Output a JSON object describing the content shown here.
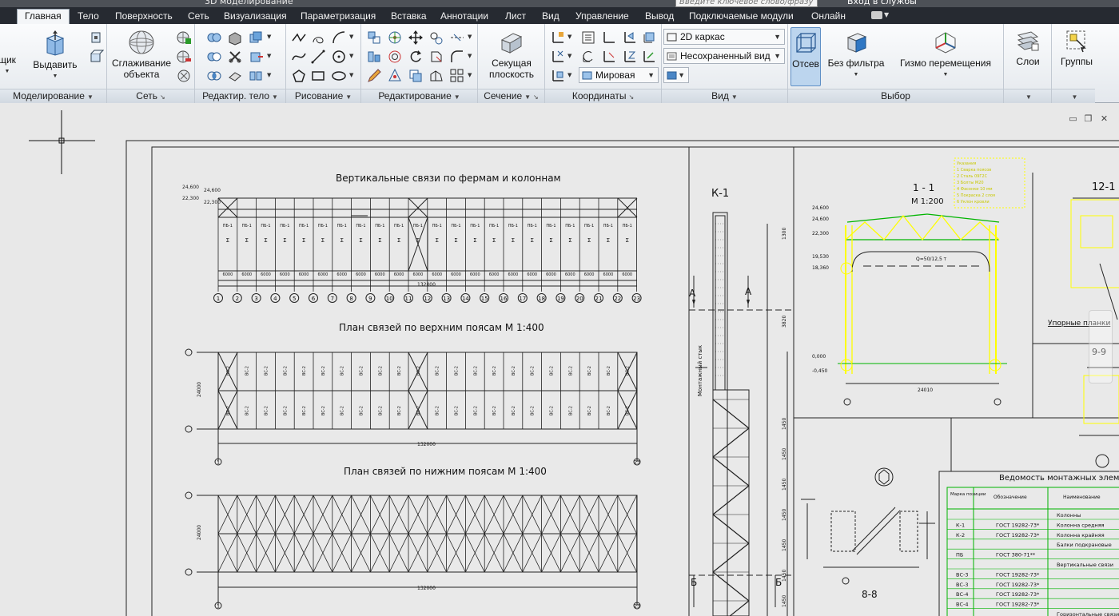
{
  "titlebar": {
    "document": "3D моделирование",
    "search_placeholder": "Введите ключевое слово/фразу",
    "login": "Вход в службы"
  },
  "tabs": [
    {
      "label": "Главная"
    },
    {
      "label": "Тело"
    },
    {
      "label": "Поверхность"
    },
    {
      "label": "Сеть"
    },
    {
      "label": "Визуализация"
    },
    {
      "label": "Параметризация"
    },
    {
      "label": "Вставка"
    },
    {
      "label": "Аннотации"
    },
    {
      "label": "Лист"
    },
    {
      "label": "Вид"
    },
    {
      "label": "Управление"
    },
    {
      "label": "Вывод"
    },
    {
      "label": "Подключаемые модули"
    },
    {
      "label": "Онлайн"
    }
  ],
  "ribbon": {
    "box_label": "щик",
    "extrude_label": "Выдавить",
    "smooth_label_1": "Сглаживание",
    "smooth_label_2": "объекта",
    "section_label_1": "Секущая",
    "section_label_2": "плоскость",
    "visual_style": "2D каркас",
    "saved_view": "Несохраненный вид",
    "ucs": "Мировая",
    "culling_label": "Отсев",
    "filter_label": "Без фильтра",
    "gizmo_label": "Гизмо перемещения",
    "layers_label": "Слои",
    "groups_label": "Группы",
    "panels": {
      "modeling": "Моделирование",
      "mesh": "Сеть",
      "solid_edit": "Редактир. тело",
      "draw": "Рисование",
      "modify": "Редактирование",
      "section": "Сечение",
      "coordinates": "Координаты",
      "view": "Вид",
      "selection": "Выбор"
    }
  },
  "drawing": {
    "title_vertical": "Вертикальные связи по фермам и колоннам",
    "title_top": "План связей по верхним поясам М 1:400",
    "title_bottom": "План связей по нижним поясам М 1:400",
    "column_mark": "К-1",
    "section_mark_1": "1 - 1",
    "section_scale": "М 1:200",
    "section_mark_12": "12-1",
    "section_99": "9-9",
    "section_88": "8-8",
    "dim_total": "132000",
    "dim_span": "24000",
    "dim_section": "24010",
    "stop_plates": "Упорные планки",
    "mounting_stage": "Монтажный стык",
    "crane": "Q=50/12,5 т",
    "marks": {
      "section_a": "А",
      "section_b": "Б"
    },
    "axis_numbers": [
      "1",
      "2",
      "3",
      "4",
      "5",
      "6",
      "7",
      "8",
      "9",
      "10",
      "11",
      "12",
      "13",
      "14",
      "15",
      "16",
      "17",
      "18",
      "19",
      "20",
      "21",
      "22",
      "23"
    ],
    "bay_dims": [
      "6000",
      "6000",
      "6000",
      "6000",
      "6000",
      "6000",
      "6000",
      "6000",
      "6000",
      "6000",
      "6000",
      "6000",
      "6000",
      "6000",
      "6000",
      "6000",
      "6000",
      "6000",
      "6000",
      "6000",
      "6000",
      "6000"
    ],
    "elev_left": [
      "24,600",
      "22,300",
      "19,530",
      "18,360",
      "0,000",
      "-0,450"
    ],
    "col_dims": [
      "1300",
      "3820",
      "1450",
      "1450",
      "1450",
      "1450",
      "1450",
      "1450",
      "1450"
    ],
    "schedule": {
      "title": "Ведомость монтажных элементов",
      "headers": [
        "Марка позиции",
        "Обозначение",
        "Наименование"
      ],
      "rows": [
        [
          "",
          "",
          "Колонны"
        ],
        [
          "К-1",
          "ГОСТ 19282-73*",
          "Колонна средняя"
        ],
        [
          "К-2",
          "ГОСТ 19282-73*",
          "Колонна крайняя"
        ],
        [
          "",
          "",
          "Балки подкрановые"
        ],
        [
          "ПБ",
          "ГОСТ 380-71**",
          ""
        ],
        [
          "",
          "",
          "Вертикальные связи"
        ],
        [
          "ВС-3",
          "ГОСТ 19282-73*",
          ""
        ],
        [
          "ВС-3",
          "ГОСТ 19282-73*",
          ""
        ],
        [
          "ВС-4",
          "ГОСТ 19282-73*",
          ""
        ],
        [
          "ВС-4",
          "ГОСТ 19282-73*",
          ""
        ],
        [
          "",
          "",
          "Горизонтальные связи"
        ]
      ]
    },
    "notes": [
      "Указания",
      "1 Сварка поясов",
      "2 Сталь 09Г2С",
      "3 Болты М20",
      "4 Фасонки 10 мм",
      "5 Покраска 2 слоя",
      "6 Уклон кровли"
    ]
  },
  "colors": {
    "accent": "#5e8fc6",
    "tabbar": "#262a31",
    "line_yellow": "#ffff00",
    "line_green": "#00b400"
  }
}
